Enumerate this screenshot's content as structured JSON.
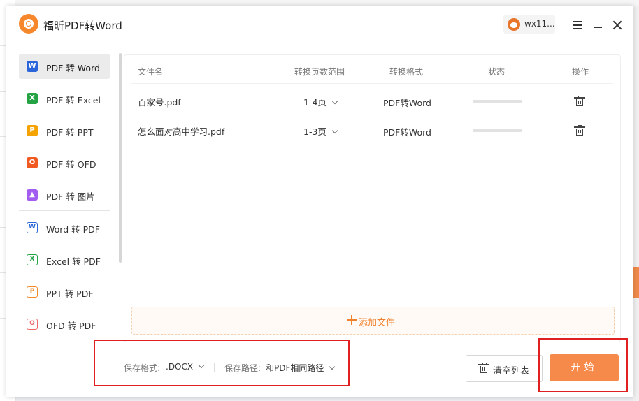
{
  "app": {
    "title": "福昕PDF转Word"
  },
  "user": {
    "name": "wx11..."
  },
  "sidebar": {
    "items": [
      {
        "label": "PDF 转 Word",
        "icon": "word-icon",
        "letter": "W",
        "color": "#2b65d9",
        "active": true
      },
      {
        "label": "PDF 转 Excel",
        "icon": "excel-icon",
        "letter": "X",
        "color": "#23a344",
        "active": false
      },
      {
        "label": "PDF 转 PPT",
        "icon": "ppt-icon",
        "letter": "P",
        "color": "#f5a300",
        "active": false
      },
      {
        "label": "PDF 转 OFD",
        "icon": "ofd-icon",
        "letter": "O",
        "color": "#f05a22",
        "active": false
      },
      {
        "label": "PDF 转 图片",
        "icon": "image-icon",
        "letter": "▲",
        "color": "#a35cf0",
        "active": false
      },
      {
        "label": "Word 转 PDF",
        "icon": "word-outline-icon",
        "letter": "W",
        "color": "#2b65d9",
        "active": false
      },
      {
        "label": "Excel 转 PDF",
        "icon": "excel-outline-icon",
        "letter": "X",
        "color": "#23a344",
        "active": false
      },
      {
        "label": "PPT 转 PDF",
        "icon": "ppt-outline-icon",
        "letter": "P",
        "color": "#f08a2c",
        "active": false
      },
      {
        "label": "OFD 转 PDF",
        "icon": "ofd-outline-icon",
        "letter": "O",
        "color": "#f06a6a",
        "active": false
      }
    ]
  },
  "table": {
    "headers": {
      "name": "文件名",
      "range": "转换页数范围",
      "format": "转换格式",
      "status": "状态",
      "action": "操作"
    },
    "rows": [
      {
        "name": "百家号.pdf",
        "range": "1-4页",
        "format": "PDF转Word",
        "progress": 0
      },
      {
        "name": "怎么面对高中学习.pdf",
        "range": "1-3页",
        "format": "PDF转Word",
        "progress": 0
      }
    ]
  },
  "add_file": {
    "label": "添加文件"
  },
  "options": {
    "format_label": "保存格式:",
    "format_value": ".DOCX",
    "path_label": "保存路径:",
    "path_value": "和PDF相同路径"
  },
  "actions": {
    "clear_label": "清空列表",
    "start_label": "开始"
  },
  "colors": {
    "accent": "#f68a4b",
    "highlight": "#e02020"
  }
}
